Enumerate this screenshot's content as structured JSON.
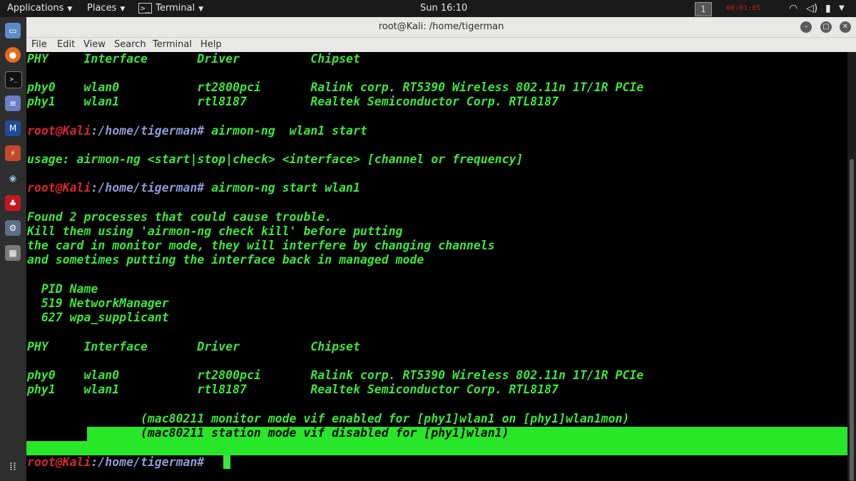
{
  "top_panel": {
    "applications": "Applications",
    "places": "Places",
    "terminal": "Terminal",
    "clock": "Sun 16:10",
    "workspace": "1",
    "rec_text": "00:01:05"
  },
  "window": {
    "title": "root@Kali: /home/tigerman",
    "menu": [
      "File",
      "Edit",
      "View",
      "Search",
      "Terminal",
      "Help"
    ]
  },
  "terminal": {
    "header1": "PHY     Interface       Driver          Chipset",
    "row1a": "phy0    wlan0           rt2800pci       Ralink corp. RT5390 Wireless 802.11n 1T/1R PCIe",
    "row1b": "phy1    wlan1           rtl8187         Realtek Semiconductor Corp. RTL8187",
    "prompt_user": "root@Kali",
    "prompt_path": ":/home/tigerman#",
    "cmd1": " airmon-ng  wlan1 start",
    "usage": "usage: airmon-ng <start|stop|check> <interface> [channel or frequency]",
    "cmd2": " airmon-ng start wlan1",
    "found1": "Found 2 processes that could cause trouble.",
    "found2": "Kill them using 'airmon-ng check kill' before putting",
    "found3": "the card in monitor mode, they will interfere by changing channels",
    "found4": "and sometimes putting the interface back in managed mode",
    "pid_header": "  PID Name",
    "pid1": "  519 NetworkManager",
    "pid2": "  627 wpa_supplicant",
    "header2": "PHY     Interface       Driver          Chipset",
    "row2a": "phy0    wlan0           rt2800pci       Ralink corp. RT5390 Wireless 802.11n 1T/1R PCIe",
    "row2b": "phy1    wlan1           rtl8187         Realtek Semiconductor Corp. RTL8187",
    "mac1": "                (mac80211 monitor mode vif enabled for [phy1]wlan1 on [phy1]wlan1mon)",
    "mac2": "                (mac80211 station mode vif disabled for [phy1]wlan1)"
  },
  "colors": {
    "text_green": "#3ce63c",
    "prompt_red": "#d9262c",
    "path_blue": "#8e9bd3",
    "selection_green": "#28e628"
  }
}
